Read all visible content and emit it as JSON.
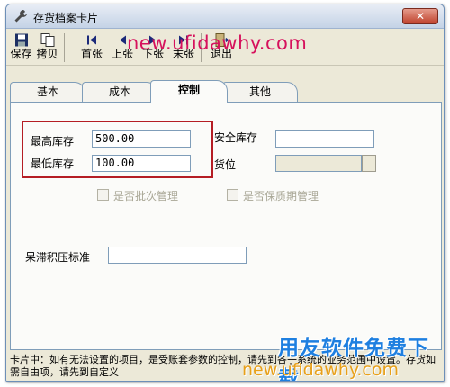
{
  "window": {
    "title": "存货档案卡片",
    "close_label": "✕"
  },
  "toolbar": {
    "buttons": [
      {
        "label": "保存",
        "icon": "floppy-disk-icon"
      },
      {
        "label": "拷贝",
        "icon": "copy-icon"
      },
      {
        "label": "首张",
        "icon": "first-record-icon"
      },
      {
        "label": "上张",
        "icon": "previous-record-icon"
      },
      {
        "label": "下张",
        "icon": "next-record-icon"
      },
      {
        "label": "末张",
        "icon": "last-record-icon"
      },
      {
        "label": "退出",
        "icon": "exit-icon"
      }
    ]
  },
  "tabs": [
    "基本",
    "成本",
    "控制",
    "其他"
  ],
  "active_tab": "控制",
  "form": {
    "min_stock_label": "最高库存",
    "min_stock_value": "500.00",
    "low_stock_label": "最低库存",
    "low_stock_value": "100.00",
    "safety_stock_label": "安全库存",
    "safety_stock_value": "",
    "location_label": "货位",
    "location_value": "",
    "batch_mgmt_label": "是否批次管理",
    "shelf_life_label": "是否保质期管理",
    "stale_label": "呆滞积压标准",
    "stale_value": ""
  },
  "status_text": "卡片中：如有无法设置的项目，是受账套参数的控制，请先到各子系统的业务范围中设置。存货如需自由项，请先到自定义",
  "watermarks": {
    "top": "new.ufidawhy.com",
    "bottom_cn": "用友软件免费下载",
    "bottom_url": "new.ufidawhy.com"
  },
  "colors": {
    "highlight_border": "#b51d24",
    "watermark_pink": "#d6115c",
    "watermark_blue": "#1e7fe0"
  }
}
